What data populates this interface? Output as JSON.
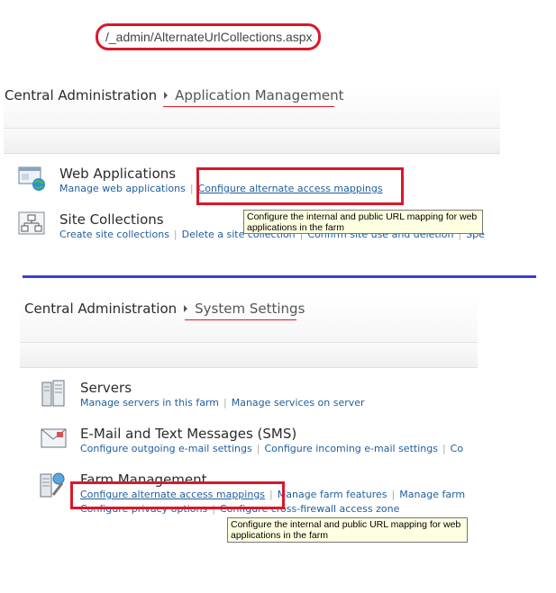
{
  "url": {
    "text": "/_admin/AlternateUrlCollections.aspx"
  },
  "top": {
    "breadcrumb": {
      "root": "Central Administration",
      "current": "Application Management"
    },
    "web_applications": {
      "title": "Web Applications",
      "links": [
        "Manage web applications",
        "Configure alternate access mappings"
      ]
    },
    "site_collections": {
      "title": "Site Collections",
      "links": [
        "Create site collections",
        "Delete a site collection",
        "Confirm site use and deletion",
        "Spe"
      ]
    },
    "tooltip": "Configure the internal and public URL mapping for web applications in the farm"
  },
  "bottom": {
    "breadcrumb": {
      "root": "Central Administration",
      "current": "System Settings"
    },
    "servers": {
      "title": "Servers",
      "links": [
        "Manage servers in this farm",
        "Manage services on server"
      ]
    },
    "email": {
      "title": "E-Mail and Text Messages (SMS)",
      "links": [
        "Configure outgoing e-mail settings",
        "Configure incoming e-mail settings",
        "Co"
      ]
    },
    "farm": {
      "title": "Farm Management",
      "links_row1": [
        "Configure alternate access mappings",
        "Manage farm features",
        "Manage farm"
      ],
      "links_row2": [
        "Configure privacy options",
        "Configure cross-firewall access zone"
      ]
    },
    "tooltip": "Configure the internal and public URL mapping for web applications in the farm"
  },
  "colors": {
    "highlight": "#d9182a",
    "divider": "#3e3ec8",
    "link": "#1f5d9c",
    "tooltip_bg": "#ffffe1"
  }
}
